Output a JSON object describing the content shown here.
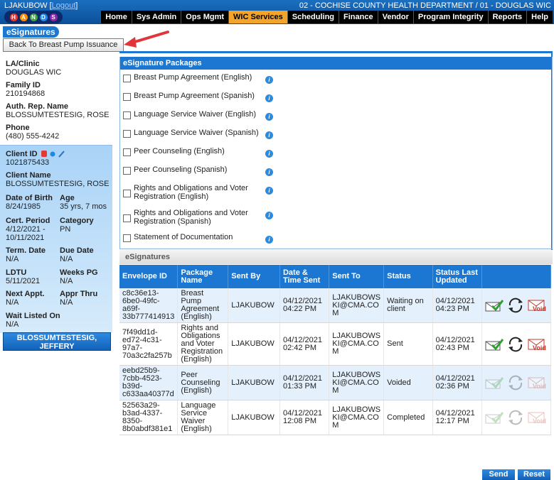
{
  "header": {
    "user_prefix": "LJAKUBOW [",
    "user_link": "Logout",
    "user_suffix": "]",
    "dept": "02 - COCHISE COUNTY HEALTH DEPARTMENT / 01 - DOUGLAS WIC",
    "logo_letters": [
      "H",
      "A",
      "N",
      "D",
      "S"
    ],
    "menu": [
      "Home",
      "Sys Admin",
      "Ops Mgmt",
      "WIC Services",
      "Scheduling",
      "Finance",
      "Vendor",
      "Program Integrity",
      "Reports",
      "Help"
    ],
    "active_menu": "WIC Services"
  },
  "page_title": "eSignatures",
  "back_button": "Back To Breast Pump Issuance",
  "family": {
    "la_clinic_label": "LA/Clinic",
    "la_clinic": "DOUGLAS WIC",
    "family_id_label": "Family ID",
    "family_id": "210194868",
    "auth_rep_label": "Auth. Rep. Name",
    "auth_rep": "BLOSSUMTESTESIG, ROSE",
    "phone_label": "Phone",
    "phone": "(480) 555-4242"
  },
  "client": {
    "client_id_label": "Client ID",
    "client_id": "1021875433",
    "client_name_label": "Client Name",
    "client_name": "BLOSSUMTESTESIG, ROSE",
    "dob_label": "Date of Birth",
    "dob": "8/24/1985",
    "age_label": "Age",
    "age": "35 yrs, 7 mos",
    "cert_label": "Cert. Period",
    "cert_1": "4/12/2021 -",
    "cert_2": "10/11/2021",
    "category_label": "Category",
    "category": "PN",
    "term_label": "Term. Date",
    "term": "N/A",
    "due_label": "Due Date",
    "due": "N/A",
    "ldtu_label": "LDTU",
    "ldtu": "5/11/2021",
    "weeks_label": "Weeks PG",
    "weeks": "N/A",
    "next_label": "Next Appt.",
    "next": "N/A",
    "appr_label": "Appr Thru",
    "appr": "N/A",
    "wait_label": "Wait Listed On",
    "wait": "N/A",
    "other_client_1": "BLOSSUMTESTESIG,",
    "other_client_2": "JEFFERY"
  },
  "packages": {
    "header": "eSignature Packages",
    "items": [
      {
        "l1": "Breast Pump Agreement (English)",
        "l2": ""
      },
      {
        "l1": "Breast Pump Agreement (Spanish)",
        "l2": ""
      },
      {
        "l1": "Language Service Waiver (English)",
        "l2": ""
      },
      {
        "l1": "Language Service Waiver (Spanish)",
        "l2": ""
      },
      {
        "l1": "Peer Counseling (English)",
        "l2": ""
      },
      {
        "l1": "Peer Counseling (Spanish)",
        "l2": ""
      },
      {
        "l1": "Rights and Obligations and Voter",
        "l2": "Registration (English)"
      },
      {
        "l1": "Rights and Obligations and Voter",
        "l2": "Registration (Spanish)"
      },
      {
        "l1": "Statement of Documentation",
        "l2": ""
      }
    ]
  },
  "esignatures": {
    "header": "eSignatures",
    "columns": [
      "Envelope ID",
      "Package Name",
      "Sent By",
      "Date & Time Sent",
      "Sent To",
      "Status",
      "Status Last Updated"
    ],
    "rows": [
      {
        "env": [
          "c8c36e13-",
          "6be0-49fc-",
          "a69f-",
          "33b777414913"
        ],
        "pkg": [
          "Breast Pump",
          "Agreement",
          "(English)"
        ],
        "by": "LJAKUBOW",
        "sent": [
          "04/12/2021",
          "04:22 PM"
        ],
        "to": [
          "LJAKUBOWS",
          "KI@CMA.CO",
          "M"
        ],
        "status": [
          "Waiting on",
          "client"
        ],
        "upd": [
          "04/12/2021",
          "04:23 PM"
        ],
        "active": true
      },
      {
        "env": [
          "7f49dd1d-",
          "ed72-4c31-",
          "97a7-",
          "70a3c2fa257b"
        ],
        "pkg": [
          "Rights and",
          "Obligations",
          "and Voter",
          "Registration",
          "(English)"
        ],
        "by": "LJAKUBOW",
        "sent": [
          "04/12/2021",
          "02:42 PM"
        ],
        "to": [
          "LJAKUBOWS",
          "KI@CMA.CO",
          "M"
        ],
        "status": [
          "Sent"
        ],
        "upd": [
          "04/12/2021",
          "02:43 PM"
        ],
        "active": true
      },
      {
        "env": [
          "eebd25b9-",
          "7cbb-4523-",
          "b39d-",
          "c633aa40377d"
        ],
        "pkg": [
          "Peer",
          "Counseling",
          "(English)"
        ],
        "by": "LJAKUBOW",
        "sent": [
          "04/12/2021",
          "01:33 PM"
        ],
        "to": [
          "LJAKUBOWS",
          "KI@CMA.CO",
          "M"
        ],
        "status": [
          "Voided"
        ],
        "upd": [
          "04/12/2021",
          "02:36 PM"
        ],
        "active": false
      },
      {
        "env": [
          "52563a29-",
          "b3ad-4337-",
          "8350-",
          "8b0abdf381e1"
        ],
        "pkg": [
          "Language",
          "Service Waiver",
          "(English)"
        ],
        "by": "LJAKUBOW",
        "sent": [
          "04/12/2021",
          "12:08 PM"
        ],
        "to": [
          "LJAKUBOWS",
          "KI@CMA.CO",
          "M"
        ],
        "status": [
          "Completed"
        ],
        "upd": [
          "04/12/2021",
          "12:17 PM"
        ],
        "active": false
      }
    ],
    "void_label": "Void"
  },
  "footer": {
    "send": "Send",
    "reset": "Reset"
  },
  "colors": {
    "primary": "#1b77d1",
    "active_menu": "#f3a52b",
    "arrow": "#e0363a"
  }
}
